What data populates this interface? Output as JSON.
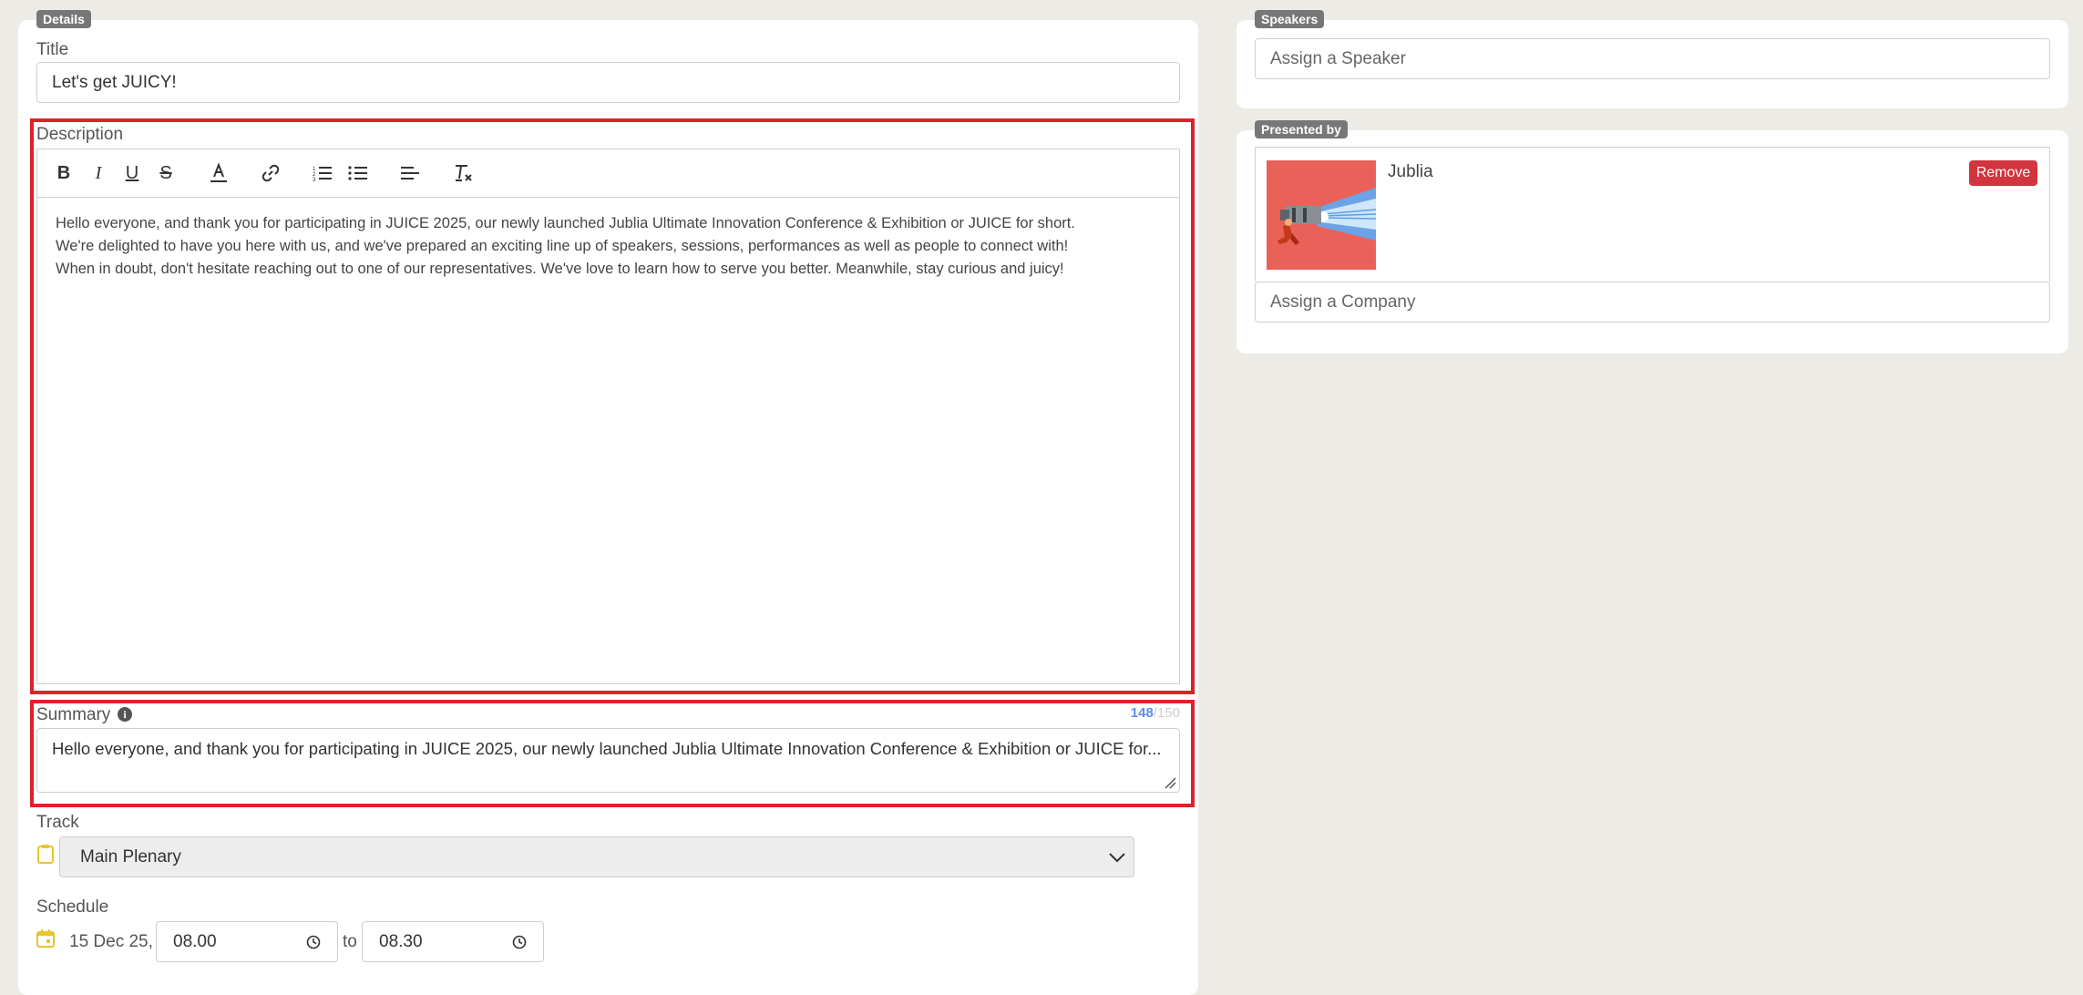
{
  "details": {
    "badge": "Details",
    "title_label": "Title",
    "title_value": "Let's get JUICY!",
    "description_label": "Description",
    "description_paragraphs": [
      "Hello everyone, and thank you for participating in JUICE 2025, our newly launched Jublia Ultimate Innovation Conference & Exhibition or JUICE for short.",
      "We're delighted to have you here with us, and we've prepared an exciting line up of speakers, sessions, performances as well as people to connect with!",
      "When in doubt, don't hesitate reaching out to one of our representatives. We've love to learn how to serve you better. Meanwhile, stay curious and juicy!"
    ],
    "toolbar_icons": [
      "bold-icon",
      "italic-icon",
      "underline-icon",
      "strikethrough-icon",
      "text-color-icon",
      "link-icon",
      "ordered-list-icon",
      "bullet-list-icon",
      "align-left-icon",
      "clear-format-icon"
    ],
    "summary_label": "Summary",
    "summary_count": "148",
    "summary_max": "/150",
    "summary_value": "Hello everyone, and thank you for participating in JUICE 2025, our newly launched Jublia Ultimate Innovation Conference & Exhibition or JUICE for...",
    "track_label": "Track",
    "track_value": "Main Plenary",
    "schedule_label": "Schedule",
    "schedule_date": "15 Dec 25,",
    "schedule_start": "08.00",
    "schedule_to": "to",
    "schedule_end": "08.30"
  },
  "speakers": {
    "badge": "Speakers",
    "placeholder": "Assign a Speaker"
  },
  "presented_by": {
    "badge": "Presented by",
    "company_name": "Jublia",
    "remove_label": "Remove",
    "company_placeholder": "Assign a Company"
  },
  "colors": {
    "highlight": "#e0202b",
    "counter": "#5b8def",
    "remove": "#d2353d",
    "calendar": "#e8c52a"
  }
}
